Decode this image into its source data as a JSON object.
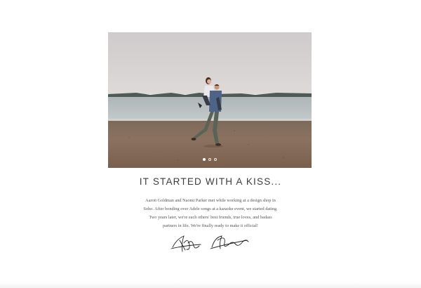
{
  "hero": {
    "image_alt": "Couple piggyback on a beach",
    "slide_count": 3,
    "active_slide": 1
  },
  "section": {
    "heading": "IT STARTED WITH A KISS...",
    "story_lines": [
      "Aaron Goldman and Naomi Parker met while working at a design shop in",
      "Soho. After bonding over Adele songs at a karaoke event, we started dating.",
      "Two years later, we're each others' best friends, true loves, and badass",
      "partners in life. We're finally ready to make it official!"
    ]
  },
  "signatures": {
    "left_icon": "signature-icon",
    "right_icon": "signature-icon"
  },
  "colors": {
    "sky": "#d8d4d3",
    "sea": "#b9c0c1",
    "sand": "#8a7260",
    "text": "#444444"
  }
}
